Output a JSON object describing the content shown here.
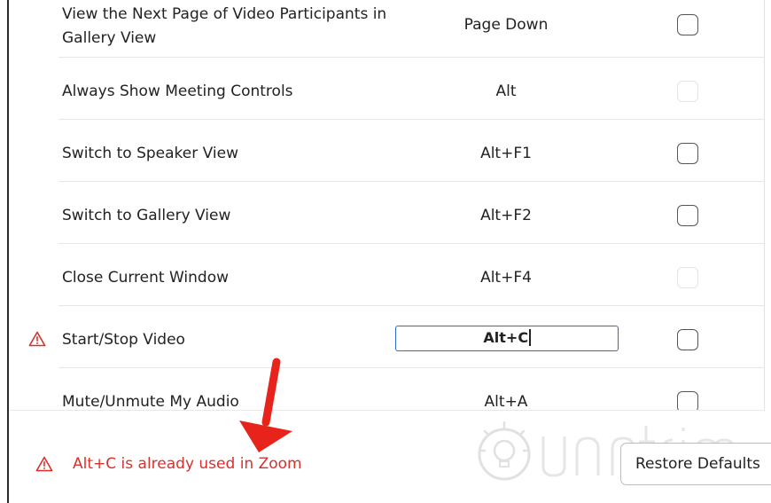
{
  "shortcuts": [
    {
      "name": "View the Next Page of Video Participants in Gallery View",
      "key": "Page Down",
      "enabled": true
    },
    {
      "name": "Always Show Meeting Controls",
      "key": "Alt",
      "enabled": false
    },
    {
      "name": "Switch to Speaker View",
      "key": "Alt+F1",
      "enabled": true
    },
    {
      "name": "Switch to Gallery View",
      "key": "Alt+F2",
      "enabled": true
    },
    {
      "name": "Close Current Window",
      "key": "Alt+F4",
      "enabled": false
    },
    {
      "name": "Start/Stop Video",
      "key": "Alt+C",
      "enabled": true,
      "editing": true
    },
    {
      "name": "Mute/Unmute My Audio",
      "key": "Alt+A",
      "enabled": true
    }
  ],
  "error": {
    "message": "Alt+C is already used in Zoom",
    "color": "#d9302c"
  },
  "restore_defaults_label": "Restore Defaults",
  "colors": {
    "error_red": "#d9302c",
    "focus_blue": "#2d6ccf",
    "text": "#222222",
    "divider": "#e6e6e6"
  },
  "icons": {
    "warning": "warning-triangle-icon",
    "annotation": "red-arrow-down-icon",
    "watermark": "lightbulb-watermark-icon"
  }
}
